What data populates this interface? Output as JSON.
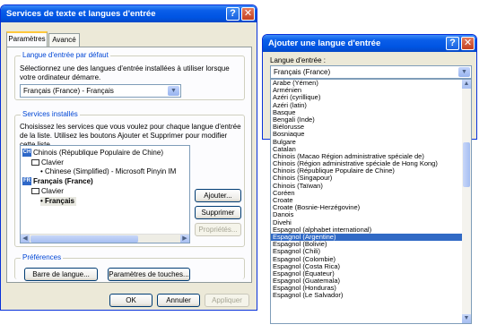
{
  "dialog1": {
    "title": "Services de texte et langues d'entrée",
    "tabs": [
      "Paramètres",
      "Avancé"
    ],
    "default_group": {
      "label": "Langue d'entrée par défaut",
      "desc": "Sélectionnez une des langues d'entrée installées à utiliser lorsque votre ordinateur démarre.",
      "combo_value": "Français (France) - Français"
    },
    "installed_group": {
      "label": "Services installés",
      "desc": "Choisissez les services que vous voulez pour chaque langue d'entrée de la liste. Utilisez les boutons Ajouter et Supprimer pour modifier cette liste.",
      "tree": {
        "chinese": {
          "badge": "CH",
          "label": "Chinois (République Populaire de Chine)",
          "keyboard": "Clavier",
          "service": "Chinese (Simplified) - Microsoft Pinyin IM"
        },
        "french": {
          "badge": "FR",
          "label": "Français (France)",
          "keyboard": "Clavier",
          "service": "Français"
        }
      },
      "add_button": "Ajouter...",
      "remove_button": "Supprimer",
      "properties_button": "Propriétés..."
    },
    "prefs_group": {
      "label": "Préférences",
      "langbar_button": "Barre de langue...",
      "keys_button": "Paramètres de touches..."
    },
    "ok_button": "OK",
    "cancel_button": "Annuler",
    "apply_button": "Appliquer"
  },
  "dialog2": {
    "title": "Ajouter une langue d'entrée",
    "field_label": "Langue d'entrée :",
    "combo_value": "Français (France)",
    "selected_index": 21,
    "options": [
      "Arabe (Yémen)",
      "Arménien",
      "Azéri (cyrillique)",
      "Azéri (latin)",
      "Basque",
      "Bengali (Inde)",
      "Biélorusse",
      "Bosniaque",
      "Bulgare",
      "Catalan",
      "Chinois (Macao Région administrative spéciale de)",
      "Chinois (Région administrative spéciale de Hong Kong)",
      "Chinois (République Populaire de Chine)",
      "Chinois (Singapour)",
      "Chinois (Taïwan)",
      "Coréen",
      "Croate",
      "Croate (Bosnie-Herzégovine)",
      "Danois",
      "Divehi",
      "Espagnol (alphabet international)",
      "Espagnol (Argentine)",
      "Espagnol (Bolivie)",
      "Espagnol (Chili)",
      "Espagnol (Colombie)",
      "Espagnol (Costa Rica)",
      "Espagnol (Équateur)",
      "Espagnol (Guatemala)",
      "Espagnol (Honduras)",
      "Espagnol (Le Salvador)"
    ]
  }
}
